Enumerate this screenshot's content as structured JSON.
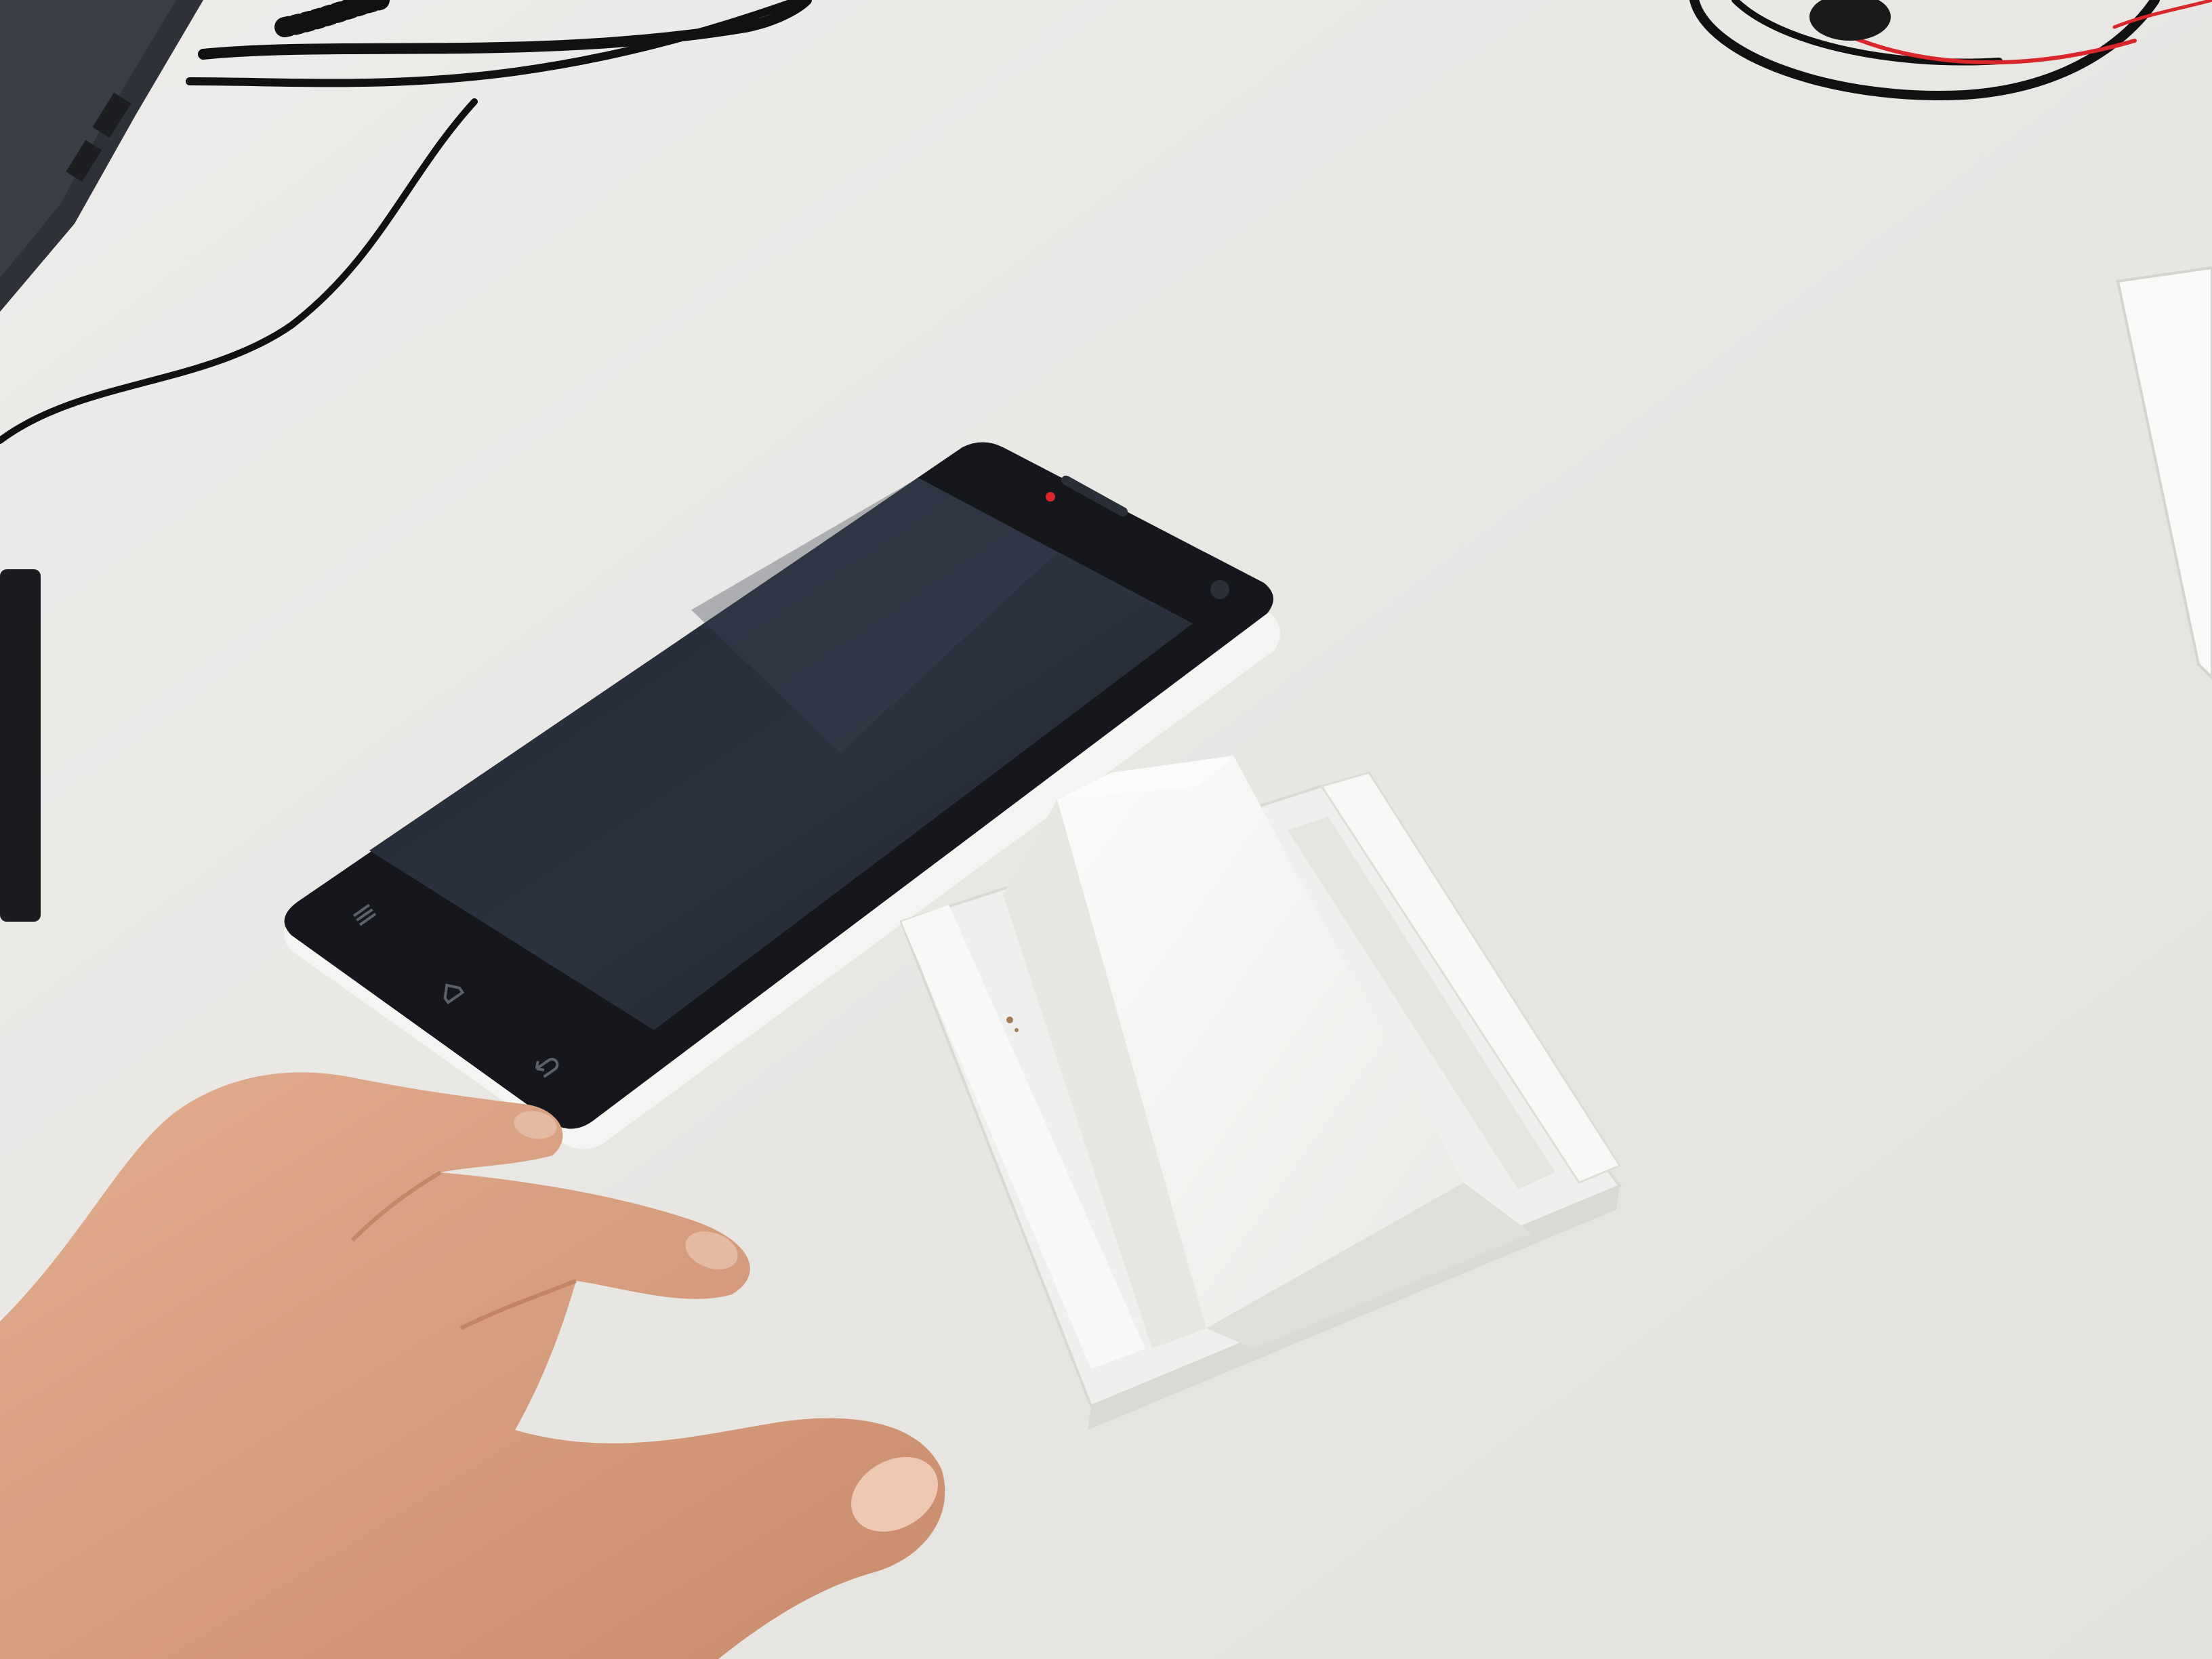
{
  "scene": {
    "desk_color": "#e9e7e3",
    "phone_body_color": "#15171d",
    "phone_screen_color": "#1b2029",
    "phone_frame_color": "#f4f4f2",
    "stand_color": "#f6f6f4",
    "skin_color": "#d79f80",
    "cable_color": "#111111",
    "accent_red": "#d9262b"
  },
  "icons": {
    "menu": "menu-icon",
    "home": "home-icon",
    "back": "back-icon"
  }
}
